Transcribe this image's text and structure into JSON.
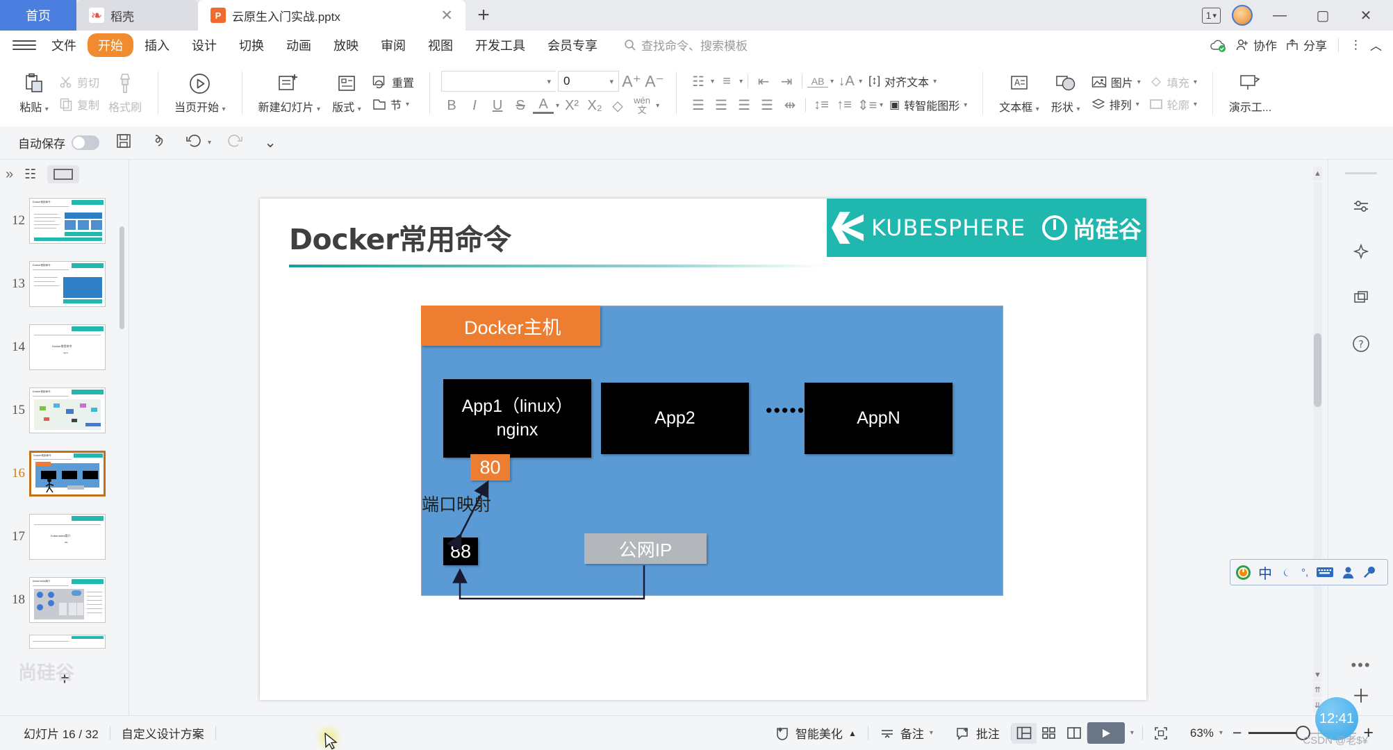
{
  "window": {
    "tabs": [
      {
        "label": "首页",
        "icon": "home-icon",
        "type": "home"
      },
      {
        "label": "稻壳",
        "icon": "docer-icon",
        "type": "docer"
      },
      {
        "label": "云原生入门实战.pptx",
        "icon": "ppt-icon",
        "type": "document",
        "active": true
      }
    ],
    "new_tab_label": "+",
    "one_badge": "1",
    "minimize": "—",
    "maximize": "▢",
    "close": "✕"
  },
  "menu": {
    "items": [
      {
        "label": "文件"
      },
      {
        "label": "开始",
        "active": true
      },
      {
        "label": "插入"
      },
      {
        "label": "设计"
      },
      {
        "label": "切换"
      },
      {
        "label": "动画"
      },
      {
        "label": "放映"
      },
      {
        "label": "审阅"
      },
      {
        "label": "视图"
      },
      {
        "label": "开发工具"
      },
      {
        "label": "会员专享"
      }
    ],
    "search_placeholder": "查找命令、搜索模板",
    "collaborate": "协作",
    "share": "分享",
    "more": "⋮",
    "collapse": "︿"
  },
  "ribbon": {
    "paste": "粘贴",
    "cut": "剪切",
    "copy": "复制",
    "format_painter": "格式刷",
    "start_from_page": "当页开始",
    "new_slide": "新建幻灯片",
    "layout": "版式",
    "reset": "重置",
    "section": "节",
    "font_name": "",
    "font_name_placeholder": "",
    "font_size": "0",
    "increase_font": "A",
    "decrease_font": "A",
    "bold": "B",
    "italic": "I",
    "underline": "U",
    "strikethrough": "S",
    "font_color": "A",
    "superscript": "X²",
    "subscript": "X₂",
    "clear_format": "◇",
    "pinyin": "wén",
    "align_text": "对齐文本",
    "to_smartart": "转智能图形",
    "textbox": "文本框",
    "shape": "形状",
    "picture": "图片",
    "fill": "填充",
    "arrange": "排列",
    "outline": "轮廓",
    "present_tools": "演示工..."
  },
  "quickbar": {
    "autosave_label": "自动保存",
    "autosave_on": false,
    "save": "save-icon",
    "export_pdf": "export-icon",
    "undo": "undo-icon",
    "redo": "redo-icon",
    "more": "more-icon"
  },
  "thumbpanel": {
    "expand_label": "»",
    "slides": [
      {
        "number": "12",
        "style": "table",
        "current": false
      },
      {
        "number": "13",
        "style": "grid",
        "current": false
      },
      {
        "number": "14",
        "style": "section",
        "current": false
      },
      {
        "number": "15",
        "style": "map",
        "current": false
      },
      {
        "number": "16",
        "style": "docker",
        "current": true
      },
      {
        "number": "17",
        "style": "section",
        "current": false
      },
      {
        "number": "18",
        "style": "k8s",
        "current": false
      }
    ],
    "add_slide": "+"
  },
  "slide": {
    "title": "Docker常用命令",
    "logo_kubesphere": "KUBESPHERE",
    "logo_atguigu": "尚硅谷",
    "diagram": {
      "host_label": "Docker主机",
      "apps": [
        {
          "lines": [
            "App1（linux）",
            "nginx"
          ]
        },
        {
          "lines": [
            "App2"
          ]
        },
        {
          "lines": [
            "AppN"
          ]
        }
      ],
      "ellipsis": "••••••",
      "container_port": "80",
      "host_port": "88",
      "mapping_label": "端口映射",
      "public_ip_label": "公网IP",
      "colors": {
        "host_bg": "#5b9bd5",
        "host_header": "#ed7d31",
        "app_box": "#000000",
        "port_container": "#ed7d31",
        "port_host": "#000000",
        "public_ip": "#b3b6bb",
        "brand_teal": "#1fb7ae"
      }
    }
  },
  "statusbar": {
    "slide_counter": "幻灯片 16 / 32",
    "design_scheme": "自定义设计方案",
    "smart_beautify": "智能美化",
    "notes": "备注",
    "comments": "批注",
    "view_normal": "normal-view-icon",
    "view_sorter": "slide-sorter-icon",
    "view_reading": "reading-view-icon",
    "play": "play-icon",
    "fit_slide": "fit-icon",
    "zoom_level": "63%",
    "zoom_out": "−",
    "zoom_in": "+"
  },
  "overlays": {
    "ime": {
      "logo": "sogou-logo",
      "mode": "中",
      "shape": "moon-icon",
      "punct": "°,",
      "keyboard": "keyboard-icon",
      "user": "user-icon",
      "tools": "wrench-icon"
    },
    "clock": "12:41",
    "watermark": "CSDN @老$¥",
    "watermark_big": "尚硅谷"
  }
}
